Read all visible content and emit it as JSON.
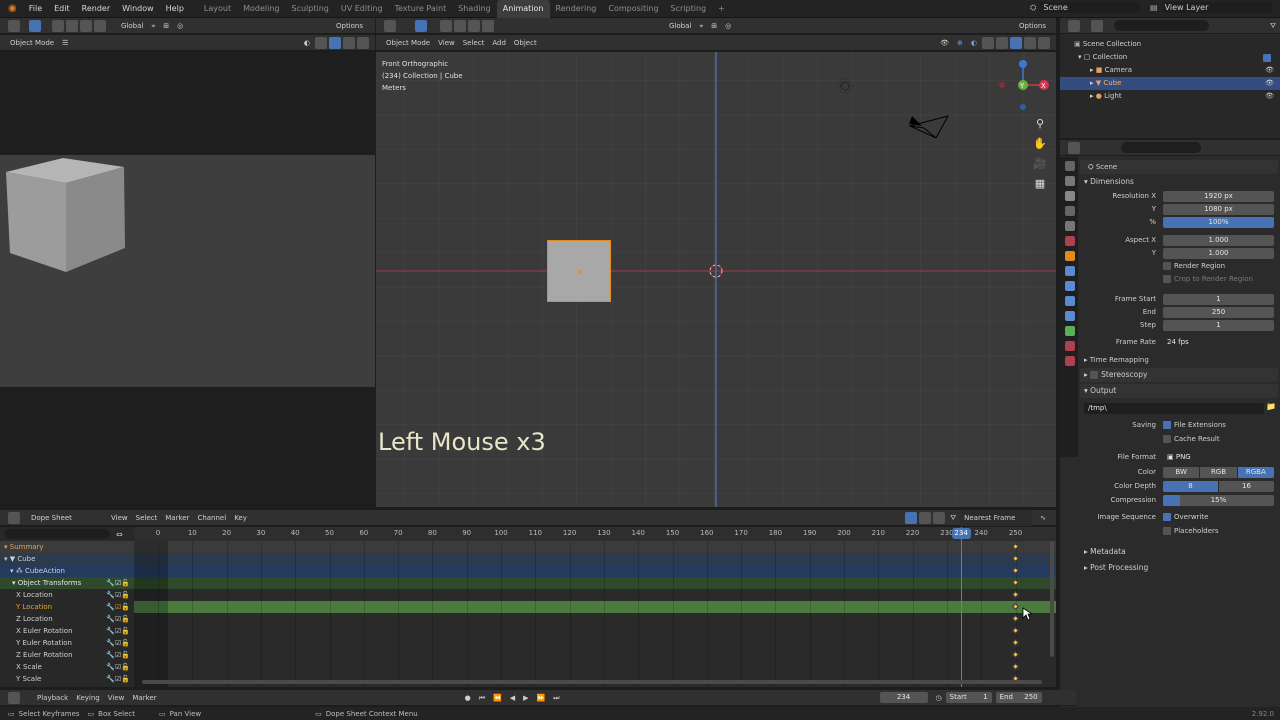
{
  "topbar": {
    "menus": [
      "File",
      "Edit",
      "Render",
      "Window",
      "Help"
    ],
    "workspaces": [
      "Layout",
      "Modeling",
      "Sculpting",
      "UV Editing",
      "Texture Paint",
      "Shading",
      "Animation",
      "Rendering",
      "Compositing",
      "Scripting"
    ],
    "active_workspace": "Animation",
    "add_tab": "+",
    "scene": "Scene",
    "view_layer": "View Layer"
  },
  "left_view": {
    "mode": "Object Mode",
    "orientation": "Global",
    "options": "Options"
  },
  "viewport": {
    "mode": "Object Mode",
    "menus": [
      "View",
      "Select",
      "Add",
      "Object"
    ],
    "orientation": "Global",
    "options": "Options",
    "info_line1": "Front Orthographic",
    "info_line2": "(234) Collection | Cube",
    "info_line3": "Meters",
    "overlay_text": "Left Mouse x3",
    "gizmo": {
      "x": "X",
      "y": "Y",
      "z": "Z"
    }
  },
  "outliner": {
    "root": "Scene Collection",
    "collection": "Collection",
    "items": [
      "Camera",
      "Cube",
      "Light"
    ]
  },
  "properties": {
    "context": "Scene",
    "dimensions_label": "Dimensions",
    "resolution_x_label": "Resolution X",
    "resolution_x": "1920 px",
    "y_label": "Y",
    "resolution_y": "1080 px",
    "percent_label": "%",
    "resolution_percent": "100%",
    "aspect_x_label": "Aspect X",
    "aspect_x": "1.000",
    "aspect_y": "1.000",
    "render_region": "Render Region",
    "crop_region": "Crop to Render Region",
    "frame_start_label": "Frame Start",
    "frame_start": "1",
    "end_label": "End",
    "frame_end": "250",
    "step_label": "Step",
    "frame_step": "1",
    "frame_rate_label": "Frame Rate",
    "frame_rate": "24 fps",
    "time_remapping": "Time Remapping",
    "stereoscopy": "Stereoscopy",
    "output_label": "Output",
    "output_path": "/tmp\\",
    "saving_label": "Saving",
    "file_extensions": "File Extensions",
    "cache_result": "Cache Result",
    "file_format_label": "File Format",
    "file_format": "PNG",
    "color_label": "Color",
    "color_options": [
      "BW",
      "RGB",
      "RGBA"
    ],
    "color_active": "RGBA",
    "color_depth_label": "Color Depth",
    "color_depth_options": [
      "8",
      "16"
    ],
    "compression_label": "Compression",
    "compression": "15%",
    "compression_value": 0.15,
    "image_sequence_label": "Image Sequence",
    "overwrite": "Overwrite",
    "placeholders": "Placeholders",
    "metadata": "Metadata",
    "post_processing": "Post Processing"
  },
  "dopesheet": {
    "editor": "Dope Sheet",
    "menus": [
      "View",
      "Select",
      "Marker",
      "Channel",
      "Key"
    ],
    "snap": "Nearest Frame",
    "ticks": [
      "0",
      "10",
      "20",
      "30",
      "40",
      "50",
      "60",
      "70",
      "80",
      "90",
      "100",
      "110",
      "120",
      "130",
      "140",
      "150",
      "160",
      "170",
      "180",
      "190",
      "200",
      "210",
      "220",
      "230",
      "240",
      "250"
    ],
    "current_frame": "234",
    "channels": [
      "Summary",
      "Cube",
      "CubeAction",
      "Object Transforms",
      "X Location",
      "Y Location",
      "Z Location",
      "X Euler Rotation",
      "Y Euler Rotation",
      "Z Euler Rotation",
      "X Scale",
      "Y Scale"
    ],
    "keyframe_at": 250
  },
  "timeline": {
    "menus": [
      "Playback",
      "Keying",
      "View",
      "Marker"
    ],
    "current_frame": "234",
    "start_label": "Start",
    "start": "1",
    "end_label": "End",
    "end": "250"
  },
  "statusbar": {
    "select": "Select Keyframes",
    "box": "Box Select",
    "pan": "Pan View",
    "context": "Dope Sheet Context Menu",
    "version": "2.92.0"
  },
  "colors": {
    "accent": "#4772b3",
    "keyframe": "#e6c45a",
    "playhead": "#5680c2",
    "selected_channel": "#3c6631"
  }
}
